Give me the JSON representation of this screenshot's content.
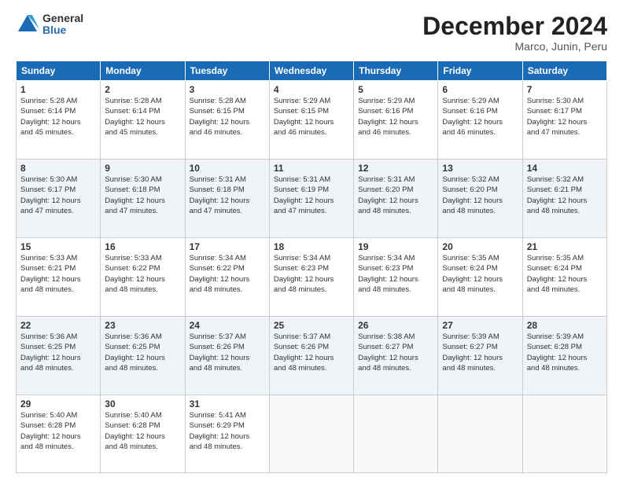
{
  "logo": {
    "general": "General",
    "blue": "Blue"
  },
  "title": "December 2024",
  "subtitle": "Marco, Junin, Peru",
  "days_of_week": [
    "Sunday",
    "Monday",
    "Tuesday",
    "Wednesday",
    "Thursday",
    "Friday",
    "Saturday"
  ],
  "weeks": [
    [
      {
        "day": "1",
        "info": "Sunrise: 5:28 AM\nSunset: 6:14 PM\nDaylight: 12 hours\nand 45 minutes."
      },
      {
        "day": "2",
        "info": "Sunrise: 5:28 AM\nSunset: 6:14 PM\nDaylight: 12 hours\nand 45 minutes."
      },
      {
        "day": "3",
        "info": "Sunrise: 5:28 AM\nSunset: 6:15 PM\nDaylight: 12 hours\nand 46 minutes."
      },
      {
        "day": "4",
        "info": "Sunrise: 5:29 AM\nSunset: 6:15 PM\nDaylight: 12 hours\nand 46 minutes."
      },
      {
        "day": "5",
        "info": "Sunrise: 5:29 AM\nSunset: 6:16 PM\nDaylight: 12 hours\nand 46 minutes."
      },
      {
        "day": "6",
        "info": "Sunrise: 5:29 AM\nSunset: 6:16 PM\nDaylight: 12 hours\nand 46 minutes."
      },
      {
        "day": "7",
        "info": "Sunrise: 5:30 AM\nSunset: 6:17 PM\nDaylight: 12 hours\nand 47 minutes."
      }
    ],
    [
      {
        "day": "8",
        "info": "Sunrise: 5:30 AM\nSunset: 6:17 PM\nDaylight: 12 hours\nand 47 minutes."
      },
      {
        "day": "9",
        "info": "Sunrise: 5:30 AM\nSunset: 6:18 PM\nDaylight: 12 hours\nand 47 minutes."
      },
      {
        "day": "10",
        "info": "Sunrise: 5:31 AM\nSunset: 6:18 PM\nDaylight: 12 hours\nand 47 minutes."
      },
      {
        "day": "11",
        "info": "Sunrise: 5:31 AM\nSunset: 6:19 PM\nDaylight: 12 hours\nand 47 minutes."
      },
      {
        "day": "12",
        "info": "Sunrise: 5:31 AM\nSunset: 6:20 PM\nDaylight: 12 hours\nand 48 minutes."
      },
      {
        "day": "13",
        "info": "Sunrise: 5:32 AM\nSunset: 6:20 PM\nDaylight: 12 hours\nand 48 minutes."
      },
      {
        "day": "14",
        "info": "Sunrise: 5:32 AM\nSunset: 6:21 PM\nDaylight: 12 hours\nand 48 minutes."
      }
    ],
    [
      {
        "day": "15",
        "info": "Sunrise: 5:33 AM\nSunset: 6:21 PM\nDaylight: 12 hours\nand 48 minutes."
      },
      {
        "day": "16",
        "info": "Sunrise: 5:33 AM\nSunset: 6:22 PM\nDaylight: 12 hours\nand 48 minutes."
      },
      {
        "day": "17",
        "info": "Sunrise: 5:34 AM\nSunset: 6:22 PM\nDaylight: 12 hours\nand 48 minutes."
      },
      {
        "day": "18",
        "info": "Sunrise: 5:34 AM\nSunset: 6:23 PM\nDaylight: 12 hours\nand 48 minutes."
      },
      {
        "day": "19",
        "info": "Sunrise: 5:34 AM\nSunset: 6:23 PM\nDaylight: 12 hours\nand 48 minutes."
      },
      {
        "day": "20",
        "info": "Sunrise: 5:35 AM\nSunset: 6:24 PM\nDaylight: 12 hours\nand 48 minutes."
      },
      {
        "day": "21",
        "info": "Sunrise: 5:35 AM\nSunset: 6:24 PM\nDaylight: 12 hours\nand 48 minutes."
      }
    ],
    [
      {
        "day": "22",
        "info": "Sunrise: 5:36 AM\nSunset: 6:25 PM\nDaylight: 12 hours\nand 48 minutes."
      },
      {
        "day": "23",
        "info": "Sunrise: 5:36 AM\nSunset: 6:25 PM\nDaylight: 12 hours\nand 48 minutes."
      },
      {
        "day": "24",
        "info": "Sunrise: 5:37 AM\nSunset: 6:26 PM\nDaylight: 12 hours\nand 48 minutes."
      },
      {
        "day": "25",
        "info": "Sunrise: 5:37 AM\nSunset: 6:26 PM\nDaylight: 12 hours\nand 48 minutes."
      },
      {
        "day": "26",
        "info": "Sunrise: 5:38 AM\nSunset: 6:27 PM\nDaylight: 12 hours\nand 48 minutes."
      },
      {
        "day": "27",
        "info": "Sunrise: 5:39 AM\nSunset: 6:27 PM\nDaylight: 12 hours\nand 48 minutes."
      },
      {
        "day": "28",
        "info": "Sunrise: 5:39 AM\nSunset: 6:28 PM\nDaylight: 12 hours\nand 48 minutes."
      }
    ],
    [
      {
        "day": "29",
        "info": "Sunrise: 5:40 AM\nSunset: 6:28 PM\nDaylight: 12 hours\nand 48 minutes."
      },
      {
        "day": "30",
        "info": "Sunrise: 5:40 AM\nSunset: 6:28 PM\nDaylight: 12 hours\nand 48 minutes."
      },
      {
        "day": "31",
        "info": "Sunrise: 5:41 AM\nSunset: 6:29 PM\nDaylight: 12 hours\nand 48 minutes."
      },
      {
        "day": "",
        "info": ""
      },
      {
        "day": "",
        "info": ""
      },
      {
        "day": "",
        "info": ""
      },
      {
        "day": "",
        "info": ""
      }
    ]
  ]
}
